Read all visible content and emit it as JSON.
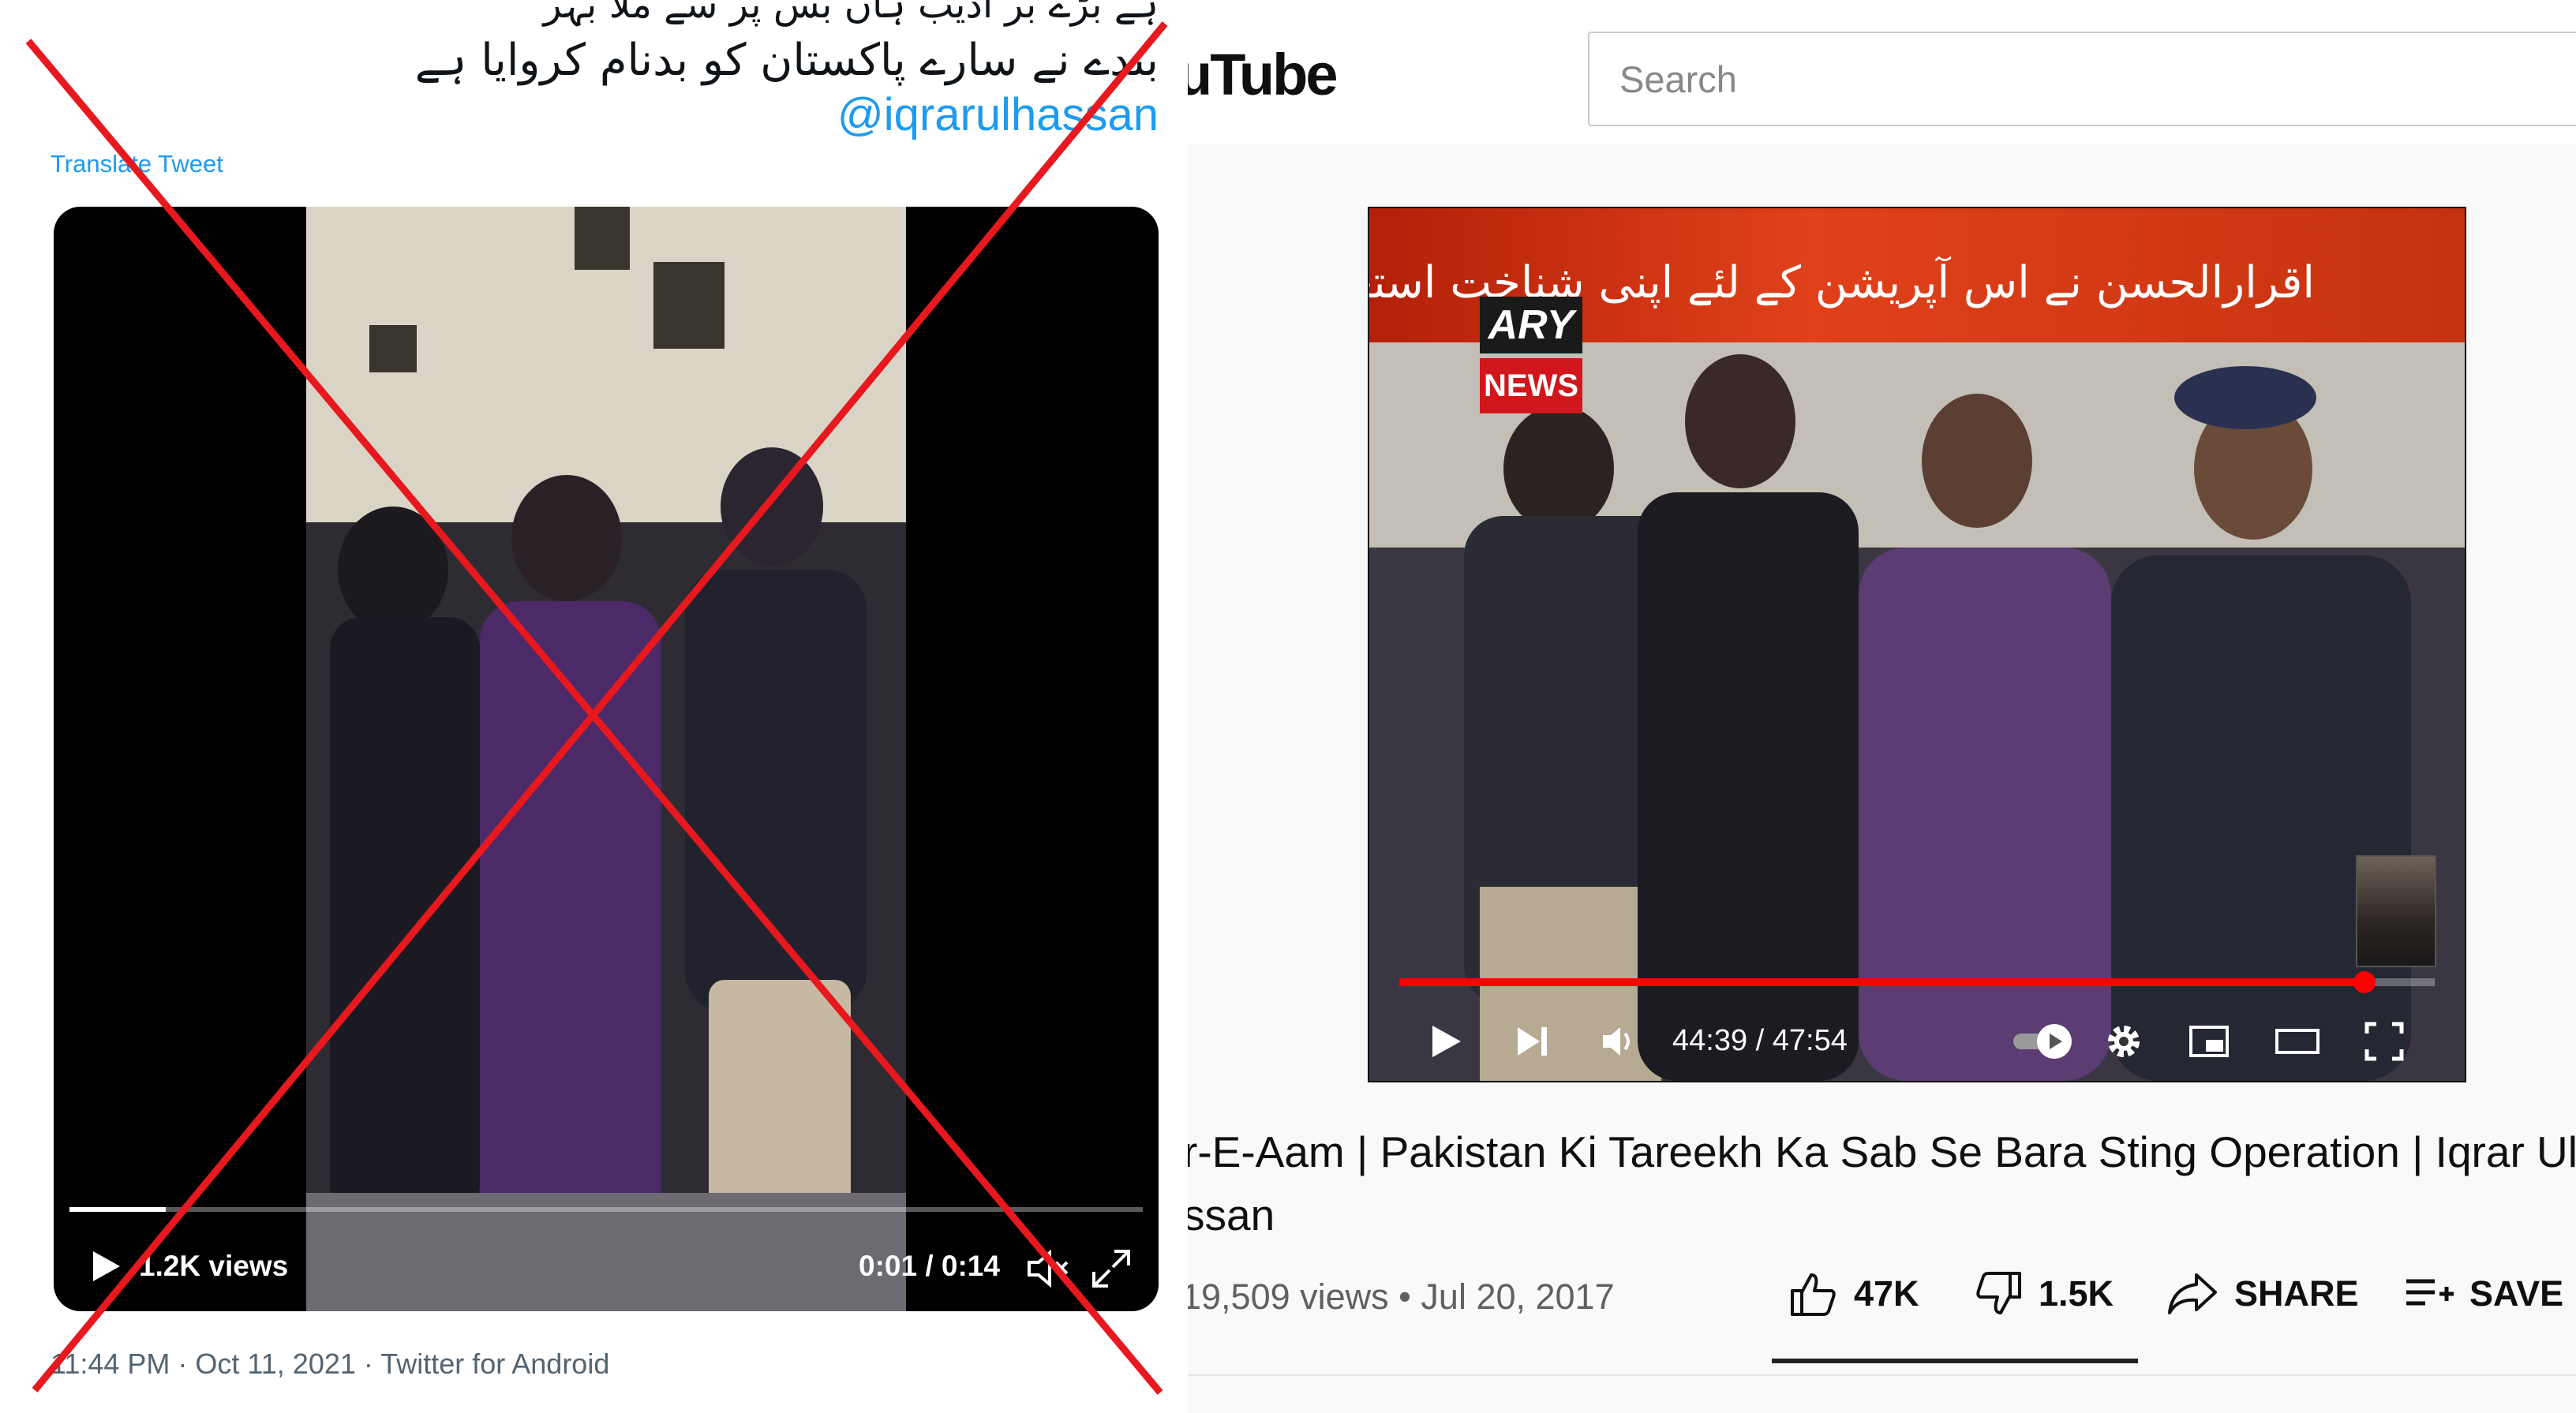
{
  "tweet": {
    "text_line_cut": "ہے بڑے بر ادیب ہاں بس پر سے ملا بہر",
    "text_line": "بندے نے سارے پاکستان کو بدنام کروایا ہے",
    "handle": "@iqrarulhassan",
    "translate_label": "Translate Tweet",
    "video": {
      "views": "1.2K views",
      "time": "0:01 / 0:14",
      "progress_fraction": 0.09
    },
    "meta": "11:44 PM · Oct 11, 2021 · Twitter for Android",
    "overlay_color": "#e8181f"
  },
  "youtube": {
    "logo_text": "uTube",
    "search_placeholder": "Search",
    "player": {
      "banner_text": "اقرارالحسن نے اس آپریشن کے لئے اپنی شناخت استعمال نہیں کی",
      "channel_logo_top": "ARY",
      "channel_logo_bottom": "NEWS",
      "time": "44:39 / 47:54",
      "progress_fraction": 0.932,
      "progress_color": "#ff0000"
    },
    "title_line1": "r-E-Aam | Pakistan Ki Tareekh Ka Sab Se Bara Sting Operation | Iqrar Ul",
    "title_line2": "ssan",
    "stats": "19,509 views • Jul 20, 2017",
    "actions": {
      "likes": "47K",
      "dislikes": "1.5K",
      "share": "SHARE",
      "save": "SAVE"
    }
  }
}
